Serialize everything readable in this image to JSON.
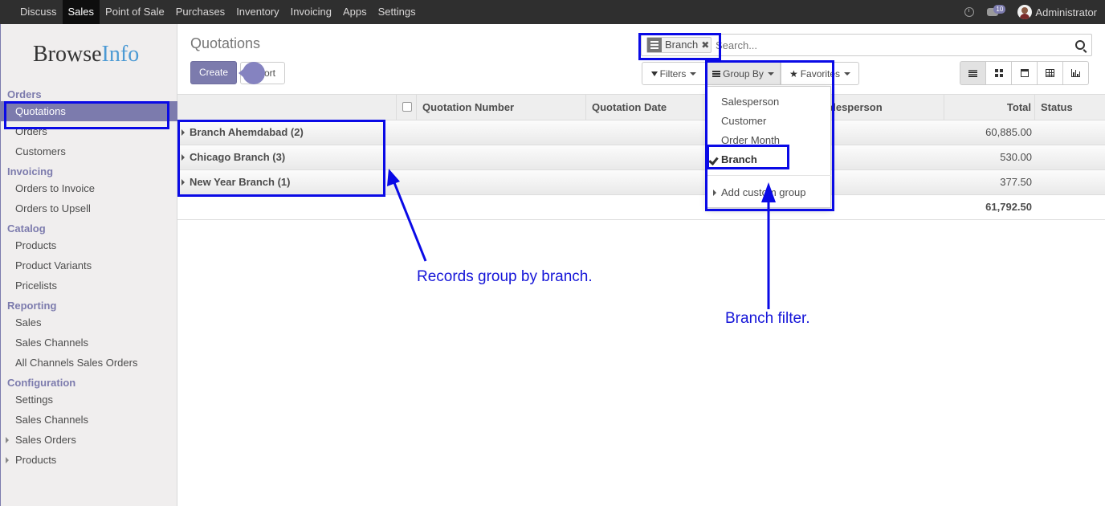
{
  "topbar": {
    "apps": [
      "Discuss",
      "Sales",
      "Point of Sale",
      "Purchases",
      "Inventory",
      "Invoicing",
      "Apps",
      "Settings"
    ],
    "active_app": "Sales",
    "message_count": "10",
    "user": "Administrator"
  },
  "logo": {
    "part1": "Browse",
    "part2": "Info"
  },
  "sidebar": {
    "sections": [
      {
        "title": "Orders",
        "items": [
          "Quotations",
          "Orders",
          "Customers"
        ]
      },
      {
        "title": "Invoicing",
        "items": [
          "Orders to Invoice",
          "Orders to Upsell"
        ]
      },
      {
        "title": "Catalog",
        "items": [
          "Products",
          "Product Variants",
          "Pricelists"
        ]
      },
      {
        "title": "Reporting",
        "items": [
          "Sales",
          "Sales Channels",
          "All Channels Sales Orders"
        ]
      },
      {
        "title": "Configuration",
        "items": [
          "Settings",
          "Sales Channels",
          "Sales Orders",
          "Products"
        ]
      }
    ],
    "active_item": "Quotations"
  },
  "page": {
    "title": "Quotations",
    "create_label": "Create",
    "import_label": "ort"
  },
  "search": {
    "facet_value": "Branch",
    "facet_remove": "✖",
    "placeholder": "Search..."
  },
  "buttons": {
    "filters": "Filters",
    "group_by": "Group By",
    "favorites": "Favorites"
  },
  "table": {
    "columns": [
      "Quotation Number",
      "Quotation Date",
      "alesperson",
      "Total",
      "Status"
    ],
    "groups": [
      {
        "name": "Branch Ahemdabad (2)",
        "total": "60,885.00"
      },
      {
        "name": "Chicago Branch (3)",
        "total": "530.00"
      },
      {
        "name": "New Year Branch (1)",
        "total": "377.50"
      }
    ],
    "grand_total": "61,792.50"
  },
  "group_by_menu": {
    "items": [
      "Salesperson",
      "Customer",
      "Order Month",
      "Branch"
    ],
    "selected": "Branch",
    "custom": "Add custom group"
  },
  "annotations": {
    "records_note": "Records group by branch.",
    "filter_note": "Branch filter.",
    "color": "#0a0ae6"
  },
  "colors": {
    "brand": "#7c7bad",
    "topbar": "#2f2f2f"
  }
}
